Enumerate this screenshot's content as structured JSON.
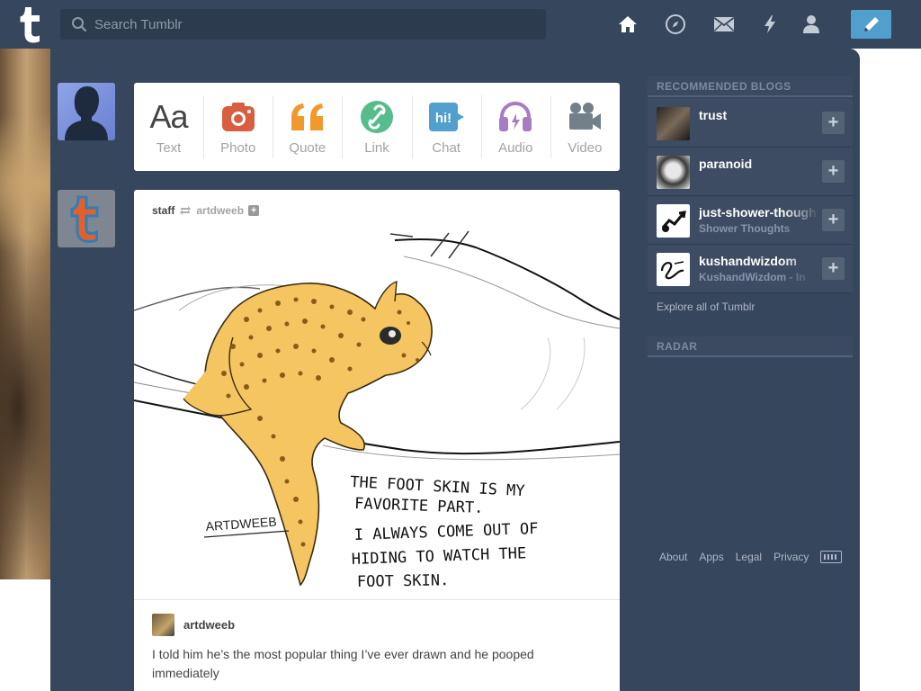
{
  "header": {
    "search_placeholder": "Search Tumblr",
    "nav": [
      "home-icon",
      "explore-compass-icon",
      "inbox-mail-icon",
      "activity-lightning-icon",
      "account-person-icon"
    ],
    "compose_icon": "pencil-icon"
  },
  "post_form": {
    "items": [
      {
        "label": "Text",
        "icon": "text-aa-icon",
        "color": "#444444"
      },
      {
        "label": "Photo",
        "icon": "camera-icon",
        "color": "#d95e40"
      },
      {
        "label": "Quote",
        "icon": "quote-icon",
        "color": "#f2992e"
      },
      {
        "label": "Link",
        "icon": "link-icon",
        "color": "#56bc8a"
      },
      {
        "label": "Chat",
        "icon": "chat-bubble-icon",
        "color": "#529ecc"
      },
      {
        "label": "Audio",
        "icon": "headphones-icon",
        "color": "#a77dc2"
      },
      {
        "label": "Video",
        "icon": "video-camera-icon",
        "color": "#748089"
      }
    ]
  },
  "post": {
    "blog": "staff",
    "reblogged_from": "artdweeb",
    "art_signature": "ARTDWEEB",
    "art_caption_1": "THE FOOT SKIN IS MY",
    "art_caption_2": "FAVORITE PART.",
    "art_caption_3": "I ALWAYS COME OUT OF",
    "art_caption_4": "HIDING TO WATCH THE",
    "art_caption_5": "FOOT SKIN.",
    "source_blog": "artdweeb",
    "body": "I told him he’s the most popular thing I’ve ever drawn and he pooped immediately"
  },
  "sidebar": {
    "recommended_title": "RECOMMENDED BLOGS",
    "blogs": [
      {
        "name": "trust",
        "subtitle": ""
      },
      {
        "name": "paranoid",
        "subtitle": ""
      },
      {
        "name": "just-shower-thoughts",
        "subtitle": "Shower Thoughts"
      },
      {
        "name": "kushandwizdom",
        "subtitle": "KushandWizdom - In"
      }
    ],
    "explore": "Explore all of Tumblr",
    "radar_title": "RADAR",
    "footer": [
      "About",
      "Apps",
      "Legal",
      "Privacy"
    ]
  },
  "colors": {
    "header_bg": "#36465d",
    "accent": "#529ecc"
  }
}
